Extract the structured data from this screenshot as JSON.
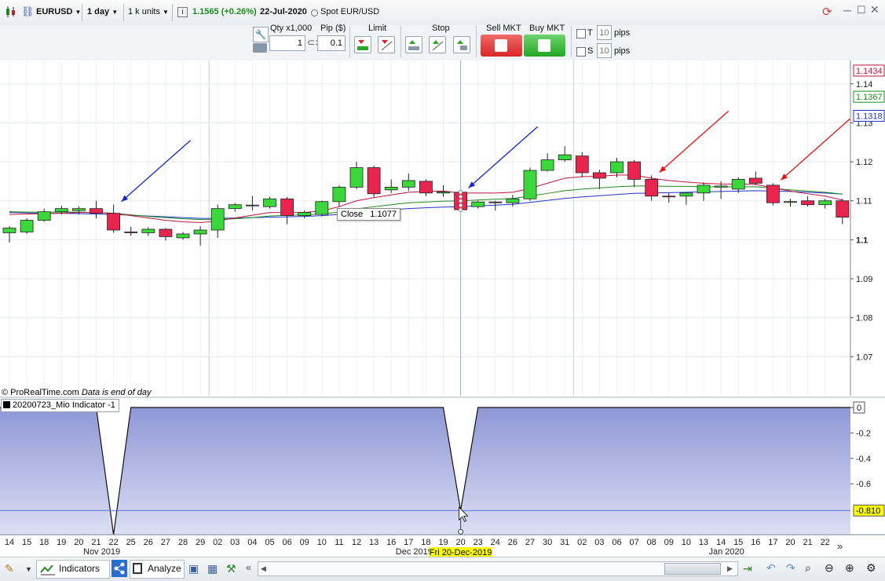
{
  "toolbar": {
    "symbol": "EURUSD",
    "timeframe": "1 day",
    "units": "1 k units",
    "price": "1.1565",
    "change": "(+0.26%)",
    "date": "22-Jul-2020",
    "instrument": "Spot EUR/USD"
  },
  "order_bar": {
    "qty_label": "Qty x1,000",
    "qty_value": "1",
    "pip_label": "Pip ($)",
    "pip_value": "0.1",
    "limit_label": "Limit",
    "stop_label": "Stop",
    "sell_label": "Sell MKT",
    "buy_label": "Buy MKT",
    "t_label": "T",
    "t_value": "10",
    "t_unit": "pips",
    "s_label": "S",
    "s_value": "10",
    "s_unit": "pips"
  },
  "chart_data": {
    "type": "candlestick",
    "ylim": [
      1.06,
      1.146
    ],
    "yticks": [
      "1.14",
      "1.13",
      "1.12",
      "1.11",
      "1.1",
      "1.09",
      "1.08",
      "1.07"
    ],
    "ytick_values": [
      1.14,
      1.13,
      1.12,
      1.11,
      1.1,
      1.09,
      1.08,
      1.07
    ],
    "price_tags": [
      {
        "label": "1.1434",
        "value": 1.1434,
        "color": "#c0143c"
      },
      {
        "label": "1.1367",
        "value": 1.1367,
        "color": "#1e8a1e"
      },
      {
        "label": "1.1318",
        "value": 1.1318,
        "color": "#2233cc"
      }
    ],
    "x_labels": [
      "14",
      "15",
      "18",
      "19",
      "20",
      "21",
      "22",
      "25",
      "26",
      "27",
      "28",
      "29",
      "02",
      "03",
      "04",
      "05",
      "06",
      "09",
      "10",
      "11",
      "12",
      "13",
      "16",
      "17",
      "18",
      "19",
      "20",
      "23",
      "24",
      "26",
      "27",
      "30",
      "31",
      "02",
      "03",
      "06",
      "07",
      "08",
      "09",
      "10",
      "13",
      "14",
      "15",
      "16",
      "17",
      "20",
      "21",
      "22"
    ],
    "month_labels": [
      {
        "label": "Nov 2019",
        "index": 5.5
      },
      {
        "label": "Dec 2019",
        "index": 23.5
      },
      {
        "label": "Jan 2020",
        "index": 41.5
      }
    ],
    "cursor_label": "Fri 20-Dec-2019",
    "cursor_index": 26,
    "candles": [
      {
        "o": 1.1018,
        "h": 1.1035,
        "l": 1.0993,
        "c": 1.103
      },
      {
        "o": 1.102,
        "h": 1.1055,
        "l": 1.1015,
        "c": 1.105
      },
      {
        "o": 1.105,
        "h": 1.108,
        "l": 1.1046,
        "c": 1.1072
      },
      {
        "o": 1.1072,
        "h": 1.1087,
        "l": 1.1065,
        "c": 1.108
      },
      {
        "o": 1.1075,
        "h": 1.1086,
        "l": 1.1065,
        "c": 1.108
      },
      {
        "o": 1.108,
        "h": 1.11,
        "l": 1.1055,
        "c": 1.1068
      },
      {
        "o": 1.1068,
        "h": 1.109,
        "l": 1.1018,
        "c": 1.1025
      },
      {
        "o": 1.102,
        "h": 1.1033,
        "l": 1.101,
        "c": 1.1018
      },
      {
        "o": 1.1018,
        "h": 1.1032,
        "l": 1.101,
        "c": 1.1027
      },
      {
        "o": 1.1027,
        "h": 1.103,
        "l": 1.0998,
        "c": 1.1008
      },
      {
        "o": 1.1005,
        "h": 1.102,
        "l": 1.1,
        "c": 1.1015
      },
      {
        "o": 1.1015,
        "h": 1.1035,
        "l": 1.0985,
        "c": 1.1025
      },
      {
        "o": 1.1025,
        "h": 1.109,
        "l": 1.1005,
        "c": 1.108
      },
      {
        "o": 1.108,
        "h": 1.1094,
        "l": 1.1072,
        "c": 1.109
      },
      {
        "o": 1.1087,
        "h": 1.1112,
        "l": 1.1075,
        "c": 1.1089
      },
      {
        "o": 1.1085,
        "h": 1.111,
        "l": 1.108,
        "c": 1.1105
      },
      {
        "o": 1.1105,
        "h": 1.111,
        "l": 1.104,
        "c": 1.1062
      },
      {
        "o": 1.1062,
        "h": 1.1075,
        "l": 1.1055,
        "c": 1.107
      },
      {
        "o": 1.1065,
        "h": 1.11,
        "l": 1.106,
        "c": 1.1098
      },
      {
        "o": 1.1098,
        "h": 1.114,
        "l": 1.1085,
        "c": 1.1135
      },
      {
        "o": 1.1135,
        "h": 1.12,
        "l": 1.113,
        "c": 1.1185
      },
      {
        "o": 1.1185,
        "h": 1.119,
        "l": 1.111,
        "c": 1.1118
      },
      {
        "o": 1.1128,
        "h": 1.1155,
        "l": 1.112,
        "c": 1.1135
      },
      {
        "o": 1.1135,
        "h": 1.117,
        "l": 1.1125,
        "c": 1.1152
      },
      {
        "o": 1.115,
        "h": 1.1155,
        "l": 1.1112,
        "c": 1.112
      },
      {
        "o": 1.112,
        "h": 1.114,
        "l": 1.111,
        "c": 1.1123
      },
      {
        "o": 1.1122,
        "h": 1.1125,
        "l": 1.1076,
        "c": 1.1077
      },
      {
        "o": 1.1085,
        "h": 1.11,
        "l": 1.108,
        "c": 1.1097
      },
      {
        "o": 1.1097,
        "h": 1.11,
        "l": 1.1075,
        "c": 1.1095
      },
      {
        "o": 1.1095,
        "h": 1.1115,
        "l": 1.1085,
        "c": 1.1105
      },
      {
        "o": 1.1105,
        "h": 1.1185,
        "l": 1.11,
        "c": 1.1178
      },
      {
        "o": 1.1178,
        "h": 1.1222,
        "l": 1.1175,
        "c": 1.1205
      },
      {
        "o": 1.1205,
        "h": 1.124,
        "l": 1.12,
        "c": 1.1218
      },
      {
        "o": 1.1215,
        "h": 1.1225,
        "l": 1.116,
        "c": 1.1172
      },
      {
        "o": 1.1172,
        "h": 1.118,
        "l": 1.113,
        "c": 1.1158
      },
      {
        "o": 1.1172,
        "h": 1.121,
        "l": 1.116,
        "c": 1.12
      },
      {
        "o": 1.12,
        "h": 1.1205,
        "l": 1.1135,
        "c": 1.1155
      },
      {
        "o": 1.1155,
        "h": 1.1165,
        "l": 1.11,
        "c": 1.1112
      },
      {
        "o": 1.1112,
        "h": 1.112,
        "l": 1.1095,
        "c": 1.111
      },
      {
        "o": 1.1112,
        "h": 1.1122,
        "l": 1.109,
        "c": 1.112
      },
      {
        "o": 1.112,
        "h": 1.1148,
        "l": 1.11,
        "c": 1.114
      },
      {
        "o": 1.1135,
        "h": 1.115,
        "l": 1.1105,
        "c": 1.1138
      },
      {
        "o": 1.113,
        "h": 1.116,
        "l": 1.112,
        "c": 1.1155
      },
      {
        "o": 1.1158,
        "h": 1.1175,
        "l": 1.114,
        "c": 1.1145
      },
      {
        "o": 1.114,
        "h": 1.1145,
        "l": 1.1088,
        "c": 1.1095
      },
      {
        "o": 1.1098,
        "h": 1.1105,
        "l": 1.1085,
        "c": 1.1098
      },
      {
        "o": 1.11,
        "h": 1.1112,
        "l": 1.1085,
        "c": 1.109
      },
      {
        "o": 1.109,
        "h": 1.1105,
        "l": 1.108,
        "c": 1.11
      },
      {
        "o": 1.11,
        "h": 1.1105,
        "l": 1.104,
        "c": 1.1058
      }
    ],
    "ma_red": [
      1.1065,
      1.1066,
      1.1067,
      1.1068,
      1.107,
      1.107,
      1.1068,
      1.1062,
      1.1056,
      1.105,
      1.1046,
      1.1044,
      1.1048,
      1.1056,
      1.1063,
      1.107,
      1.107,
      1.107,
      1.1074,
      1.1085,
      1.11,
      1.1108,
      1.1115,
      1.1122,
      1.1124,
      1.1125,
      1.112,
      1.112,
      1.112,
      1.1122,
      1.1132,
      1.1145,
      1.1158,
      1.1162,
      1.1163,
      1.1166,
      1.1166,
      1.1158,
      1.1152,
      1.1148,
      1.1145,
      1.1143,
      1.1143,
      1.1142,
      1.1133,
      1.1125,
      1.1118,
      1.1112,
      1.1102
    ],
    "ma_green": [
      1.1072,
      1.1071,
      1.1071,
      1.1071,
      1.1071,
      1.107,
      1.1068,
      1.1064,
      1.106,
      1.1057,
      1.1054,
      1.1052,
      1.1052,
      1.1054,
      1.1057,
      1.1061,
      1.1063,
      1.1064,
      1.1066,
      1.1071,
      1.1079,
      1.1085,
      1.109,
      1.1095,
      1.1097,
      1.1099,
      1.11,
      1.1102,
      1.1104,
      1.1106,
      1.1112,
      1.1119,
      1.1126,
      1.113,
      1.1133,
      1.1136,
      1.1138,
      1.1138,
      1.1137,
      1.1137,
      1.1136,
      1.1136,
      1.1136,
      1.1136,
      1.1132,
      1.1128,
      1.1125,
      1.1122,
      1.1117
    ],
    "ma_blue": [
      1.107,
      1.1069,
      1.1068,
      1.1068,
      1.1067,
      1.1066,
      1.1065,
      1.1063,
      1.1061,
      1.1059,
      1.1057,
      1.1055,
      1.1055,
      1.1056,
      1.1057,
      1.1058,
      1.1059,
      1.106,
      1.1062,
      1.1065,
      1.107,
      1.1074,
      1.1077,
      1.108,
      1.1082,
      1.1084,
      1.1085,
      1.1087,
      1.1089,
      1.1091,
      1.1096,
      1.1101,
      1.1106,
      1.111,
      1.1113,
      1.1116,
      1.1119,
      1.112,
      1.1121,
      1.1122,
      1.1123,
      1.1124,
      1.1125,
      1.1126,
      1.1125,
      1.1124,
      1.1122,
      1.112,
      1.1117
    ],
    "tooltip": {
      "label": "Close",
      "value": "1.1077"
    },
    "credit": "© ProRealTime.com",
    "credit_note": "Data is end of day",
    "indicator": {
      "name": "20200723_Mio Indicator -1",
      "ylim": [
        -1.0,
        0.0
      ],
      "yticks": [
        "0",
        "-0.2",
        "-0.4",
        "-0.6"
      ],
      "ytick_values": [
        0,
        -0.2,
        -0.4,
        -0.6
      ],
      "current_label": "-0.810",
      "current_value": -0.81,
      "values": [
        0,
        0,
        0,
        0,
        0,
        0,
        -1,
        0,
        0,
        0,
        0,
        0,
        0,
        0,
        0,
        0,
        0,
        0,
        0,
        0,
        0,
        0,
        0,
        0,
        0,
        0,
        -0.81,
        0,
        0,
        0,
        0,
        0,
        0,
        0,
        0,
        0,
        0,
        0,
        0,
        0,
        0,
        0,
        0,
        0,
        0,
        0,
        0,
        0,
        0
      ]
    },
    "arrows": [
      {
        "color": "#1428c8",
        "index": 6
      },
      {
        "color": "#1428c8",
        "index": 26
      },
      {
        "color": "#e81010",
        "index": 37
      },
      {
        "color": "#e81010",
        "index": 44
      }
    ]
  },
  "bottom_bar": {
    "indicators_label": "Indicators",
    "analyze_label": "Analyze"
  }
}
